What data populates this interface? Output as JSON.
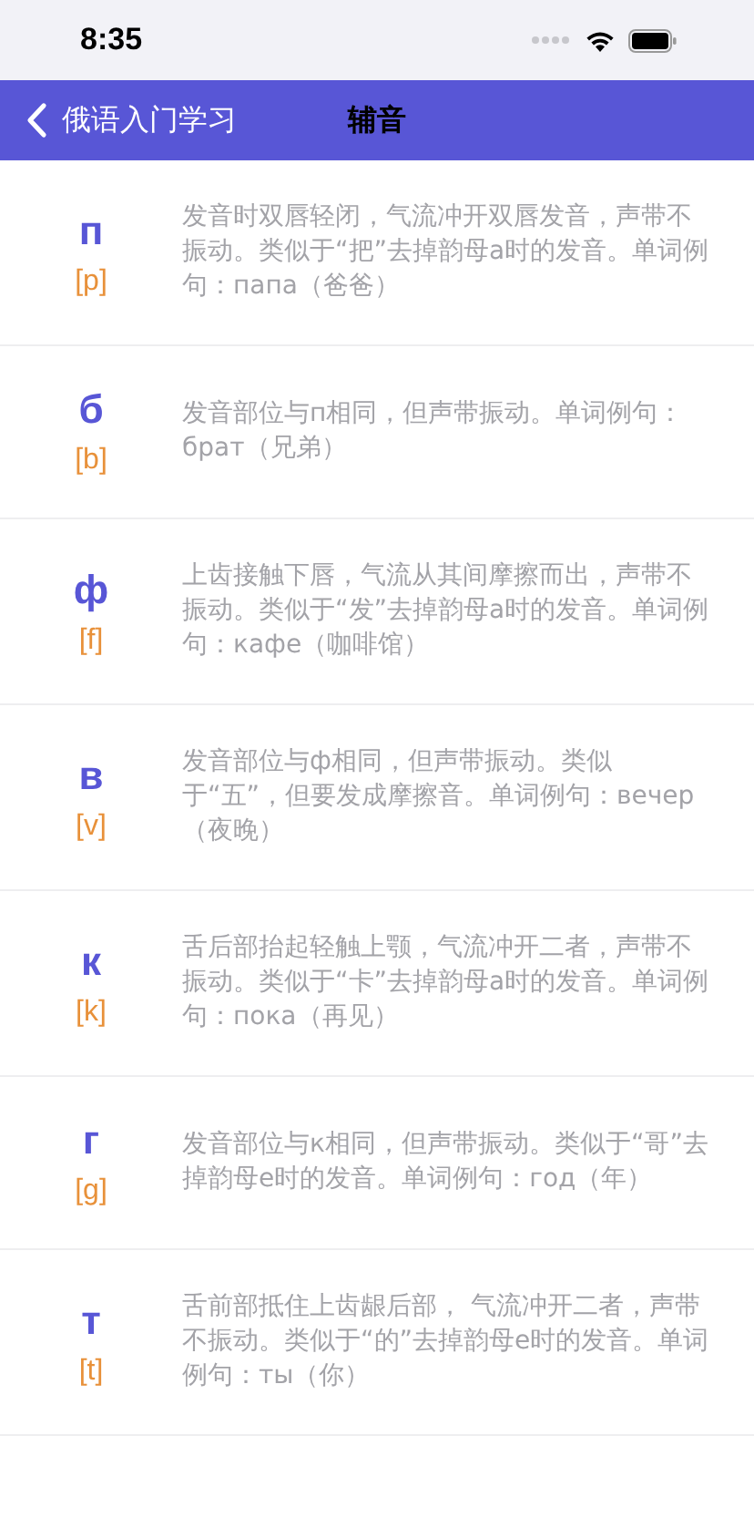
{
  "status_bar": {
    "time": "8:35"
  },
  "nav_bar": {
    "back_label": "俄语入门学习",
    "title": "辅音"
  },
  "consonants": [
    {
      "letter": "п",
      "ipa": "[p]",
      "description": "发音时双唇轻闭，气流冲开双唇发音，声带不振动。类似于“把”去掉韵母a时的发音。单词例句：папа（爸爸）"
    },
    {
      "letter": "б",
      "ipa": "[b]",
      "description": "发音部位与п相同，但声带振动。单词例句：брат（兄弟）"
    },
    {
      "letter": "ф",
      "ipa": "[f]",
      "description": "上齿接触下唇，气流从其间摩擦而出，声带不振动。类似于“发”去掉韵母a时的发音。单词例句：кафе（咖啡馆）"
    },
    {
      "letter": "в",
      "ipa": "[v]",
      "description": "发音部位与ф相同，但声带振动。类似于“五”，但要发成摩擦音。单词例句：вечер（夜晚）"
    },
    {
      "letter": "к",
      "ipa": "[k]",
      "description": "舌后部抬起轻触上颚，气流冲开二者，声带不振动。类似于“卡”去掉韵母a时的发音。单词例句：пока（再见）"
    },
    {
      "letter": "г",
      "ipa": "[g]",
      "description": "发音部位与к相同，但声带振动。类似于“哥”去掉韵母e时的发音。单词例句：год（年）"
    },
    {
      "letter": "т",
      "ipa": "[t]",
      "description": "舌前部抵住上齿龈后部， 气流冲开二者，声带不振动。类似于“的”去掉韵母e时的发音。单词例句：ты（你）"
    }
  ]
}
